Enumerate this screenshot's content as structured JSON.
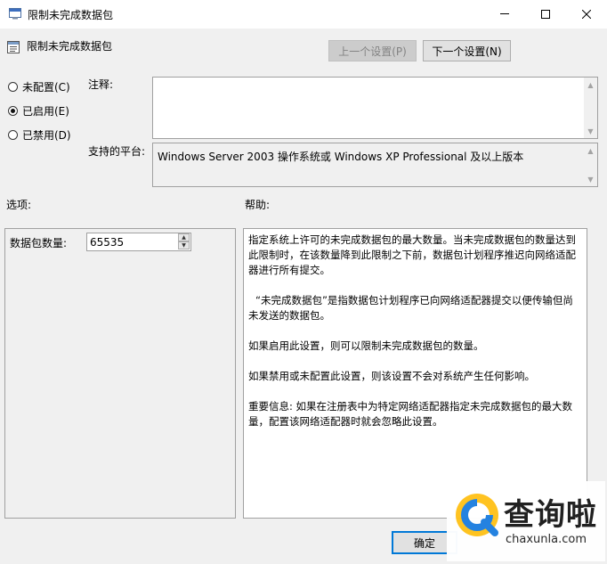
{
  "window": {
    "title": "限制未完成数据包",
    "controls": {
      "minimize": "—",
      "maximize": "☐",
      "close": "✕"
    }
  },
  "header": {
    "policy_title": "限制未完成数据包",
    "prev_button": "上一个设置(P)",
    "next_button": "下一个设置(N)"
  },
  "state": {
    "options": [
      {
        "label": "未配置(C)",
        "checked": false
      },
      {
        "label": "已启用(E)",
        "checked": true
      },
      {
        "label": "已禁用(D)",
        "checked": false
      }
    ]
  },
  "comment": {
    "label": "注释:",
    "value": ""
  },
  "platform": {
    "label": "支持的平台:",
    "value": "Windows Server 2003 操作系统或 Windows XP Professional 及以上版本"
  },
  "options_section": {
    "label": "选项:",
    "packet_count_label": "数据包数量:",
    "packet_count_value": "65535"
  },
  "help": {
    "label": "帮助:",
    "paragraphs": [
      "指定系统上许可的未完成数据包的最大数量。当未完成数据包的数量达到此限制时，在该数量降到此限制之下前，数据包计划程序推迟向网络适配器进行所有提交。",
      "“未完成数据包”是指数据包计划程序已向网络适配器提交以便传输但尚未发送的数据包。",
      "如果启用此设置，则可以限制未完成数据包的数量。",
      "如果禁用或未配置此设置，则该设置不会对系统产生任何影响。",
      "重要信息: 如果在注册表中为特定网络适配器指定未完成数据包的最大数量，配置该网络适配器时就会忽略此设置。"
    ]
  },
  "footer": {
    "ok_button": "确定"
  },
  "watermark": {
    "brand": "查询啦",
    "domain": "chaxunla.com"
  },
  "colors": {
    "accent": "#0078d7",
    "watermark_blue": "#1e7fe0",
    "watermark_yellow": "#ffc21a"
  }
}
